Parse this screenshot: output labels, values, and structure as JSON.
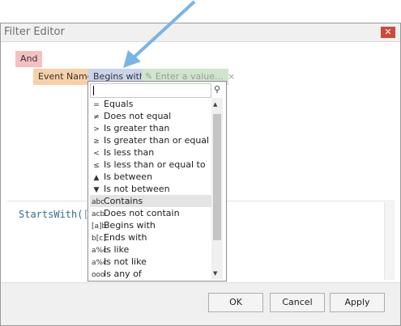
{
  "window": {
    "title": "Filter Editor"
  },
  "filter": {
    "group_op": "And",
    "field": "Event Name",
    "operator": "Begins with",
    "value_placeholder": "Enter a value...",
    "remove": "×"
  },
  "expression": {
    "prefix": "StartsWith(",
    "bracket": "["
  },
  "dropdown": {
    "items": [
      {
        "icon": "=",
        "label": "Equals"
      },
      {
        "icon": "≠",
        "label": "Does not equal"
      },
      {
        "icon": ">",
        "label": "Is greater than"
      },
      {
        "icon": "≥",
        "label": "Is greater than or equal to"
      },
      {
        "icon": "<",
        "label": "Is less than"
      },
      {
        "icon": "≤",
        "label": "Is less than or equal to"
      },
      {
        "icon": "▲",
        "label": "Is between"
      },
      {
        "icon": "▼",
        "label": "Is not between"
      },
      {
        "icon": "abc",
        "label": "Contains"
      },
      {
        "icon": "acb",
        "label": "Does not contain"
      },
      {
        "icon": "[a]b",
        "label": "Begins with"
      },
      {
        "icon": "b[c]",
        "label": "Ends with"
      },
      {
        "icon": "a%c",
        "label": "Is like"
      },
      {
        "icon": "a%c",
        "label": "Is not like"
      },
      {
        "icon": "ooo",
        "label": "Is any of"
      }
    ]
  },
  "buttons": {
    "ok": "OK",
    "cancel": "Cancel",
    "apply": "Apply"
  }
}
